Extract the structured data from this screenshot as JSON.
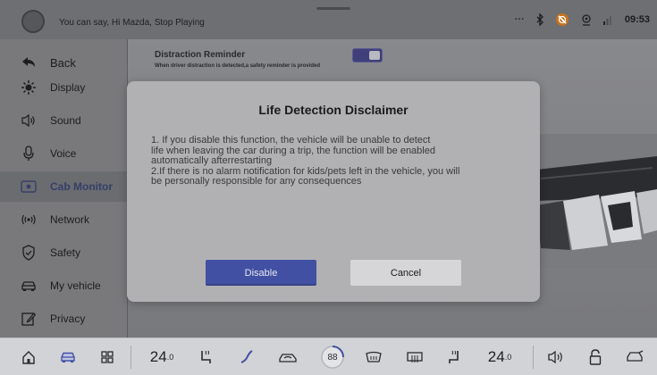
{
  "status_bar": {
    "assistant_hint": "You can say, Hi Mazda, Stop Playing",
    "dots": "···",
    "clock": "09:53",
    "icons": [
      "bluetooth-icon",
      "mute-icon",
      "wireless-icon",
      "signal-icon"
    ]
  },
  "sidebar": {
    "back_label": "Back",
    "items": [
      {
        "label": "Display",
        "icon": "brightness-icon"
      },
      {
        "label": "Sound",
        "icon": "speaker-icon"
      },
      {
        "label": "Voice",
        "icon": "microphone-icon"
      },
      {
        "label": "Cab Monitor",
        "icon": "camera-icon",
        "active": true
      },
      {
        "label": "Network",
        "icon": "network-icon"
      },
      {
        "label": "Safety",
        "icon": "shield-icon"
      },
      {
        "label": "My vehicle",
        "icon": "car-icon"
      },
      {
        "label": "Privacy",
        "icon": "edit-icon"
      }
    ]
  },
  "content": {
    "setting_title": "Distraction Reminder",
    "setting_desc": "When driver distraction is detected,a safety reminder is provided",
    "toggle_on": true
  },
  "dialog": {
    "title": "Life Detection Disclaimer",
    "body_lines": [
      "1. If you disable this function, the vehicle will be unable to detect",
      "life when leaving the car during a trip, the function will be enabled",
      "automatically afterrestarting",
      "2.If there is no alarm notification for kids/pets left in the vehicle, you will",
      "be personally responsible for any consequences"
    ],
    "disable_label": "Disable",
    "cancel_label": "Cancel"
  },
  "bottom_bar": {
    "left_temp": "24",
    "left_temp_decimal": ".0",
    "right_temp": "24",
    "right_temp_decimal": ".0",
    "fan_level": "88"
  },
  "colors": {
    "accent": "#4150a2",
    "active_text": "#34406a"
  }
}
